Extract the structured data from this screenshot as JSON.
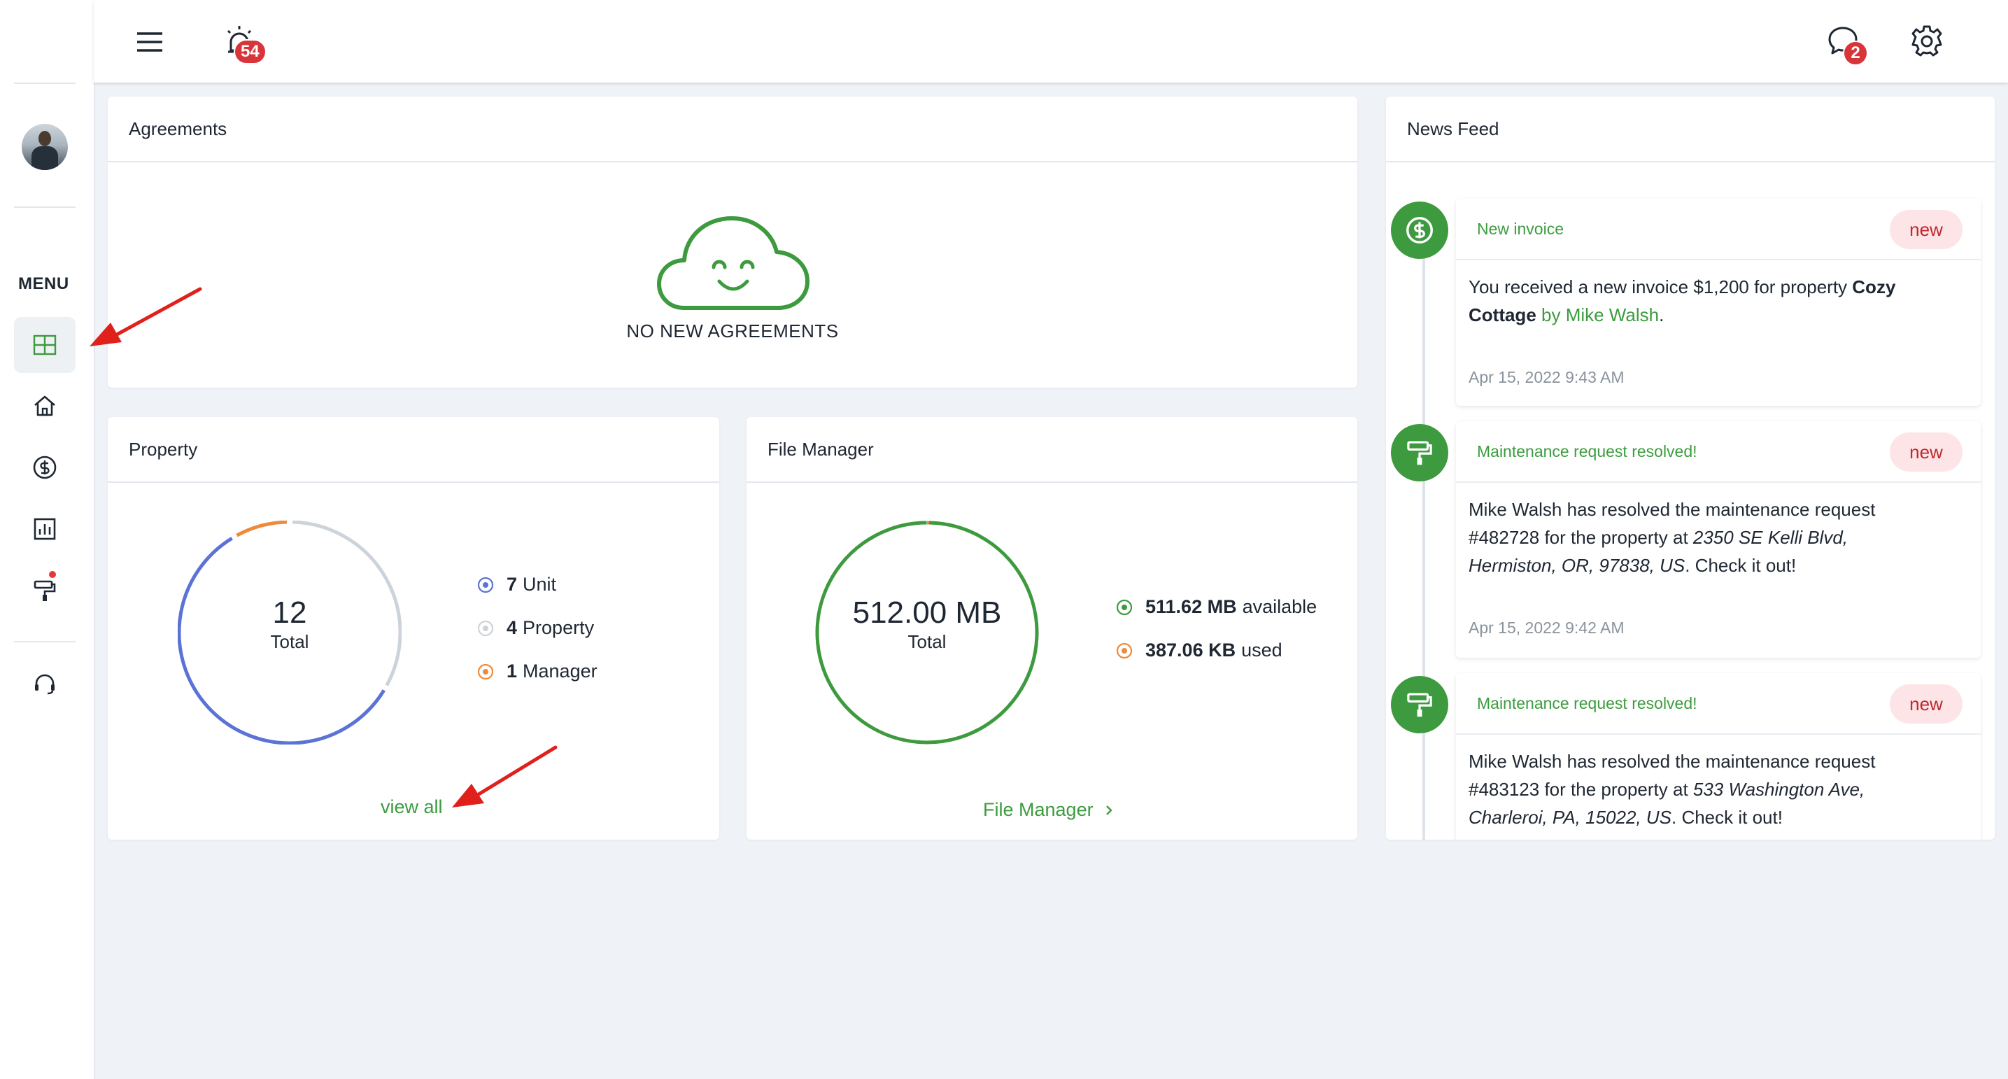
{
  "topbar": {
    "notification_count": "54",
    "message_count": "2"
  },
  "sidebar": {
    "menu_label": "MENU",
    "items": [
      {
        "name": "dashboard",
        "icon": "dashboard-icon",
        "active": true
      },
      {
        "name": "properties",
        "icon": "home-icon"
      },
      {
        "name": "payments",
        "icon": "dollar-icon"
      },
      {
        "name": "reports",
        "icon": "bar-chart-icon"
      },
      {
        "name": "maintenance",
        "icon": "paint-roller-icon",
        "has_alert": true
      },
      {
        "name": "support",
        "icon": "headset-icon"
      }
    ]
  },
  "agreements": {
    "title": "Agreements",
    "empty_text": "NO NEW AGREEMENTS"
  },
  "property": {
    "title": "Property",
    "total_value": "12",
    "total_label": "Total",
    "legend": [
      {
        "count": "7",
        "label": "Unit",
        "color": "#5b72d6",
        "value": 7
      },
      {
        "count": "4",
        "label": "Property",
        "color": "#cdd3db",
        "value": 4
      },
      {
        "count": "1",
        "label": "Manager",
        "color": "#ee8a3c",
        "value": 1
      }
    ],
    "view_all": "view all"
  },
  "file_manager": {
    "title": "File Manager",
    "total_value": "512.00 MB",
    "total_label": "Total",
    "legend": [
      {
        "amount": "511.62 MB",
        "label": "available",
        "color": "#3d9a3e"
      },
      {
        "amount": "387.06 KB",
        "label": "used",
        "color": "#ee8a3c"
      }
    ],
    "used_fraction": 0.0007,
    "link": "File Manager"
  },
  "news_feed": {
    "title": "News Feed",
    "items": [
      {
        "icon": "dollar-icon",
        "title": "New invoice",
        "badge": "new",
        "text1": "You received a new invoice $1,200 for property ",
        "bold1": "Cozy",
        "bold2": "Cottage",
        "green_text": " by Mike Walsh",
        "text2": ".",
        "time": "Apr 15, 2022 9:43 AM"
      },
      {
        "icon": "paint-roller-icon",
        "title": "Maintenance request resolved!",
        "badge": "new",
        "line1": "Mike Walsh has resolved the maintenance request",
        "line2a": "#482728 for the property at ",
        "line2b": "2350 SE Kelli Blvd,",
        "line3a": "Hermiston, OR, 97838, US",
        "line3b": ". Check it out!",
        "time": "Apr 15, 2022 9:42 AM"
      },
      {
        "icon": "paint-roller-icon",
        "title": "Maintenance request resolved!",
        "badge": "new",
        "line1": "Mike Walsh has resolved the maintenance request",
        "line2a": "#483123 for the property at ",
        "line2b": "533 Washington Ave,",
        "line3a": "Charleroi, PA, 15022, US",
        "line3b": ". Check it out!"
      }
    ]
  },
  "colors": {
    "accent_green": "#3d9a3e",
    "badge_red": "#d8353b",
    "annotation_red": "#e0201b"
  }
}
